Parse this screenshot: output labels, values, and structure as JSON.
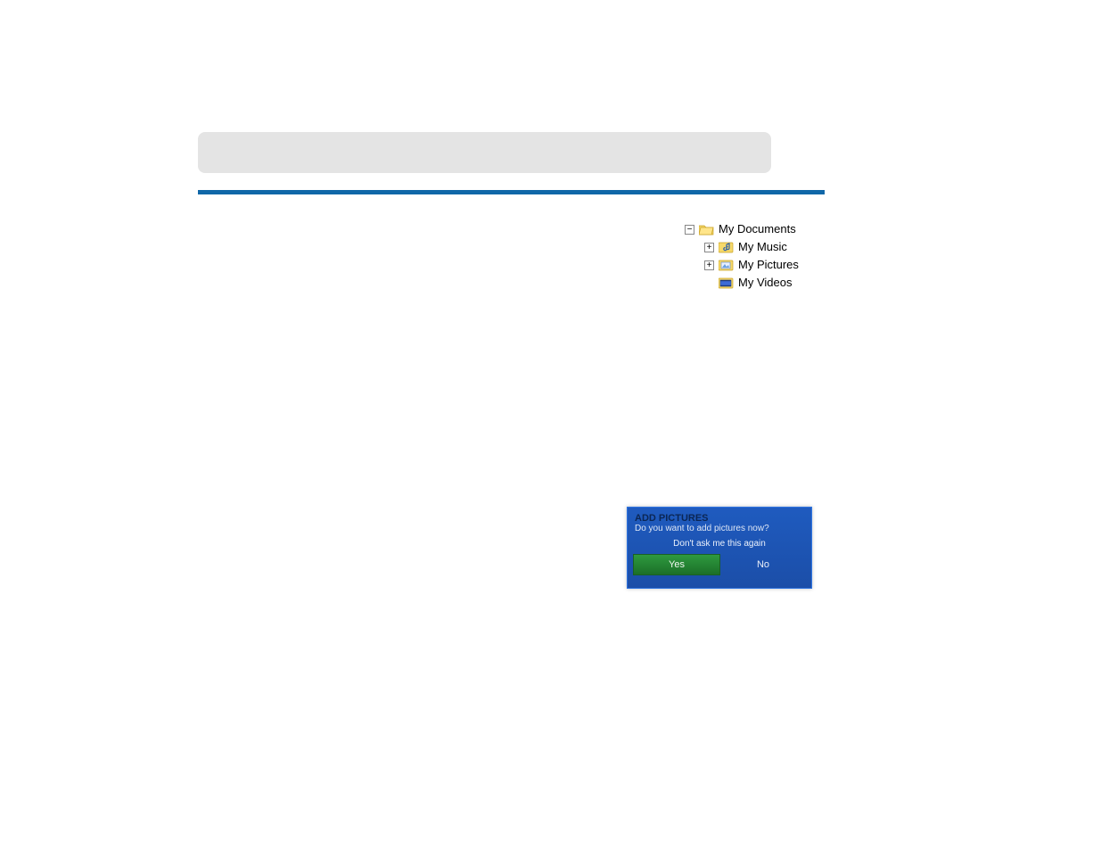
{
  "tree": {
    "root": {
      "label": "My Documents",
      "expander": "−"
    },
    "children": [
      {
        "label": "My Music",
        "expander": "+"
      },
      {
        "label": "My Pictures",
        "expander": "+"
      },
      {
        "label": "My Videos",
        "expander": ""
      }
    ]
  },
  "dialog": {
    "title": "ADD PICTURES",
    "subtitle": "Do you want to add pictures now?",
    "checkbox_label": "Don't ask me this again",
    "yes_label": "Yes",
    "no_label": "No"
  }
}
